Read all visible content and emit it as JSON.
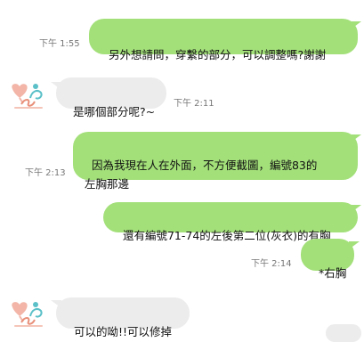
{
  "messages": [
    {
      "text": "另外想請問，穿繫的部分，可以調整嗎?謝謝",
      "time": "下午 1:55"
    },
    {
      "text": "是哪個部分呢?~",
      "time": "下午 2:11"
    },
    {
      "text": "因為我現在人在外面，不方便截圖，編號83的\n左胸那邊",
      "time": "下午 2:13"
    },
    {
      "text": "還有編號71-74的左後第二位(灰衣)的有胸",
      "time": ""
    },
    {
      "text": "*右胸",
      "time": "下午 2:14"
    },
    {
      "text": "可以的呦!!可以修掉",
      "time": ""
    }
  ],
  "avatar": {
    "icon": "shop-logo-icon",
    "brand_color": "#e8907a"
  },
  "colors": {
    "outgoing_bubble": "#a3e07a",
    "incoming_bubble": "#ececec",
    "timestamp": "#777777"
  }
}
